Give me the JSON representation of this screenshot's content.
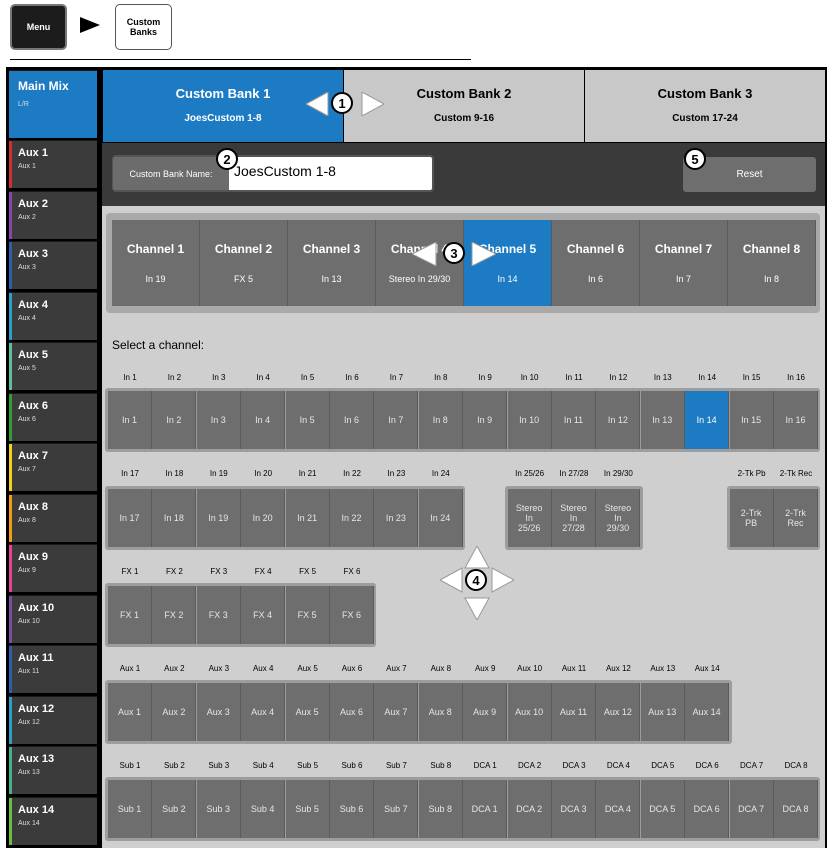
{
  "breadcrumb": {
    "menu_label": "Menu",
    "custom_banks_label": "Custom\nBanks"
  },
  "sidebar": {
    "main": {
      "label": "Main Mix",
      "sub": "L/R"
    },
    "items": [
      {
        "label": "Aux 1",
        "sub": "Aux 1",
        "color": "#d0312d"
      },
      {
        "label": "Aux 2",
        "sub": "Aux 2",
        "color": "#8e44ad"
      },
      {
        "label": "Aux 3",
        "sub": "Aux 3",
        "color": "#2e5eaa"
      },
      {
        "label": "Aux 4",
        "sub": "Aux 4",
        "color": "#2aa1c9"
      },
      {
        "label": "Aux 5",
        "sub": "Aux 5",
        "color": "#5bbfa0"
      },
      {
        "label": "Aux 6",
        "sub": "Aux 6",
        "color": "#2e9e3b"
      },
      {
        "label": "Aux 7",
        "sub": "Aux 7",
        "color": "#f2d21b"
      },
      {
        "label": "Aux 8",
        "sub": "Aux 8",
        "color": "#f39c12"
      },
      {
        "label": "Aux 9",
        "sub": "Aux 9",
        "color": "#e84393"
      },
      {
        "label": "Aux 10",
        "sub": "Aux 10",
        "color": "#7d4ea0"
      },
      {
        "label": "Aux 11",
        "sub": "Aux 11",
        "color": "#2e5eaa"
      },
      {
        "label": "Aux 12",
        "sub": "Aux 12",
        "color": "#2aa1c9"
      },
      {
        "label": "Aux 13",
        "sub": "Aux 13",
        "color": "#3fb58f"
      },
      {
        "label": "Aux 14",
        "sub": "Aux 14",
        "color": "#6cbf3a"
      }
    ]
  },
  "banks": [
    {
      "title": "Custom Bank 1",
      "sub": "JoesCustom 1-8",
      "active": true
    },
    {
      "title": "Custom Bank 2",
      "sub": "Custom 9-16",
      "active": false
    },
    {
      "title": "Custom Bank 3",
      "sub": "Custom 17-24",
      "active": false
    }
  ],
  "name_field": {
    "label": "Custom Bank Name:",
    "value": "JoesCustom 1-8"
  },
  "reset_label": "Reset",
  "slots": [
    {
      "title": "Channel 1",
      "sub": "In 19"
    },
    {
      "title": "Channel 2",
      "sub": "FX 5"
    },
    {
      "title": "Channel 3",
      "sub": "In 13"
    },
    {
      "title": "Channel 4",
      "sub": "Stereo In 29/30"
    },
    {
      "title": "Channel 5",
      "sub": "In 14",
      "active": true
    },
    {
      "title": "Channel 6",
      "sub": "In 6"
    },
    {
      "title": "Channel 7",
      "sub": "In 7"
    },
    {
      "title": "Channel 8",
      "sub": "In 8"
    }
  ],
  "select_label": "Select a channel:",
  "rows": {
    "inputs1": [
      "In 1",
      "In 2",
      "In 3",
      "In 4",
      "In 5",
      "In 6",
      "In 7",
      "In 8",
      "In 9",
      "In 10",
      "In 11",
      "In 12",
      "In 13",
      "In 14",
      "In 15",
      "In 16"
    ],
    "inputs2": [
      "In 17",
      "In 18",
      "In 19",
      "In 20",
      "In 21",
      "In 22",
      "In 23",
      "In 24"
    ],
    "stereo_headers": [
      "In 25/26",
      "In 27/28",
      "In 29/30"
    ],
    "stereo_buttons": [
      "Stereo\nIn\n25/26",
      "Stereo\nIn\n27/28",
      "Stereo\nIn\n29/30"
    ],
    "tk_headers": [
      "2-Tk Pb",
      "2-Tk Rec"
    ],
    "tk_buttons": [
      "2-Trk\nPB",
      "2-Trk\nRec"
    ],
    "fx": [
      "FX 1",
      "FX 2",
      "FX 3",
      "FX 4",
      "FX 5",
      "FX 6"
    ],
    "aux": [
      "Aux 1",
      "Aux 2",
      "Aux 3",
      "Aux 4",
      "Aux 5",
      "Aux 6",
      "Aux 7",
      "Aux 8",
      "Aux 9",
      "Aux 10",
      "Aux 11",
      "Aux 12",
      "Aux 13",
      "Aux 14"
    ],
    "subdca": [
      "Sub 1",
      "Sub 2",
      "Sub 3",
      "Sub 4",
      "Sub 5",
      "Sub 6",
      "Sub 7",
      "Sub 8",
      "DCA 1",
      "DCA 2",
      "DCA 3",
      "DCA 4",
      "DCA 5",
      "DCA 6",
      "DCA 7",
      "DCA 8"
    ]
  },
  "active_input": "In 14",
  "callouts": [
    "1",
    "2",
    "3",
    "4",
    "5"
  ]
}
